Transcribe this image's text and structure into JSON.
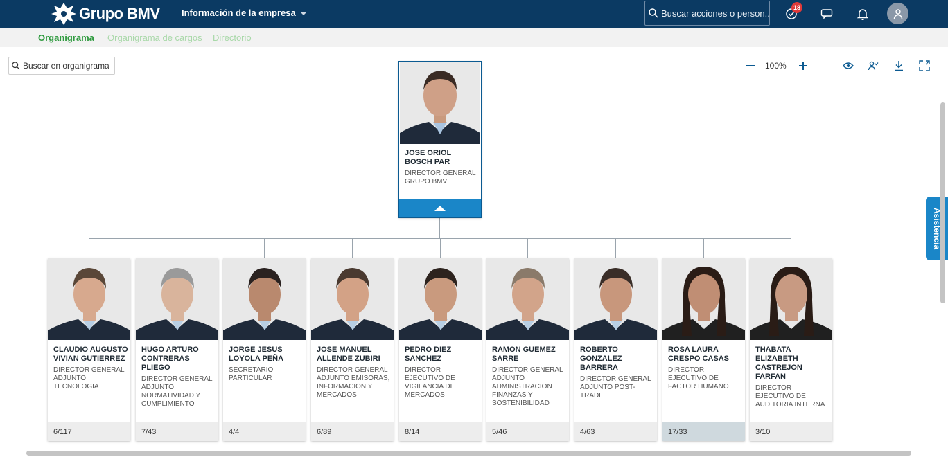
{
  "brand": {
    "name": "Grupo BMV",
    "primary": "#0b3a63",
    "accent": "#1a86c8",
    "tab_active": "#2e9a3e"
  },
  "header": {
    "company_menu": "Información de la empresa",
    "search_placeholder": "Buscar acciones o person...",
    "notifications_count": "18",
    "icons": [
      "tasks-check-icon",
      "feedback-icon",
      "bell-icon",
      "user-avatar-icon"
    ]
  },
  "subnav": {
    "tabs": [
      {
        "label": "Organigrama",
        "active": true
      },
      {
        "label": "Organigrama de cargos",
        "active": false
      },
      {
        "label": "Directorio",
        "active": false
      }
    ]
  },
  "org_search": {
    "placeholder": "Buscar en organigrama"
  },
  "toolbar": {
    "zoom": "100%",
    "icons": [
      "zoom-out-icon",
      "zoom-in-icon",
      "eye-icon",
      "user-check-icon",
      "download-icon",
      "fullscreen-icon"
    ]
  },
  "root": {
    "name": "JOSE ORIOL BOSCH PAR",
    "role": "DIRECTOR GENERAL GRUPO BMV"
  },
  "reports": [
    {
      "name": "CLAUDIO AUGUSTO VIVIAN GUTIERREZ",
      "role": "DIRECTOR GENERAL ADJUNTO TECNOLOGIA",
      "count": "6/117"
    },
    {
      "name": "HUGO ARTURO CONTRERAS PLIEGO",
      "role": "DIRECTOR GENERAL ADJUNTO NORMATIVIDAD Y CUMPLIMIENTO",
      "count": "7/43"
    },
    {
      "name": "JORGE JESUS LOYOLA PEÑA",
      "role": "SECRETARIO PARTICULAR",
      "count": "4/4"
    },
    {
      "name": "JOSE MANUEL ALLENDE ZUBIRI",
      "role": "DIRECTOR GENERAL ADJUNTO EMISORAS, INFORMACION Y MERCADOS",
      "count": "6/89"
    },
    {
      "name": "PEDRO DIEZ SANCHEZ",
      "role": "DIRECTOR EJECUTIVO DE VIGILANCIA DE MERCADOS",
      "count": "8/14"
    },
    {
      "name": "RAMON GUEMEZ SARRE",
      "role": "DIRECTOR GENERAL ADJUNTO ADMINISTRACION FINANZAS Y SOSTENIBILIDAD",
      "count": "5/46"
    },
    {
      "name": "ROBERTO GONZALEZ BARRERA",
      "role": "DIRECTOR GENERAL ADJUNTO POST-TRADE",
      "count": "4/63"
    },
    {
      "name": "ROSA LAURA CRESPO CASAS",
      "role": "DIRECTOR EJECUTIVO DE FACTOR HUMANO",
      "count": "17/33"
    },
    {
      "name": "THABATA ELIZABETH CASTREJON FARFAN",
      "role": "DIRECTOR EJECUTIVO DE AUDITORIA INTERNA",
      "count": "3/10"
    }
  ],
  "assist_tab": "Asistencia"
}
